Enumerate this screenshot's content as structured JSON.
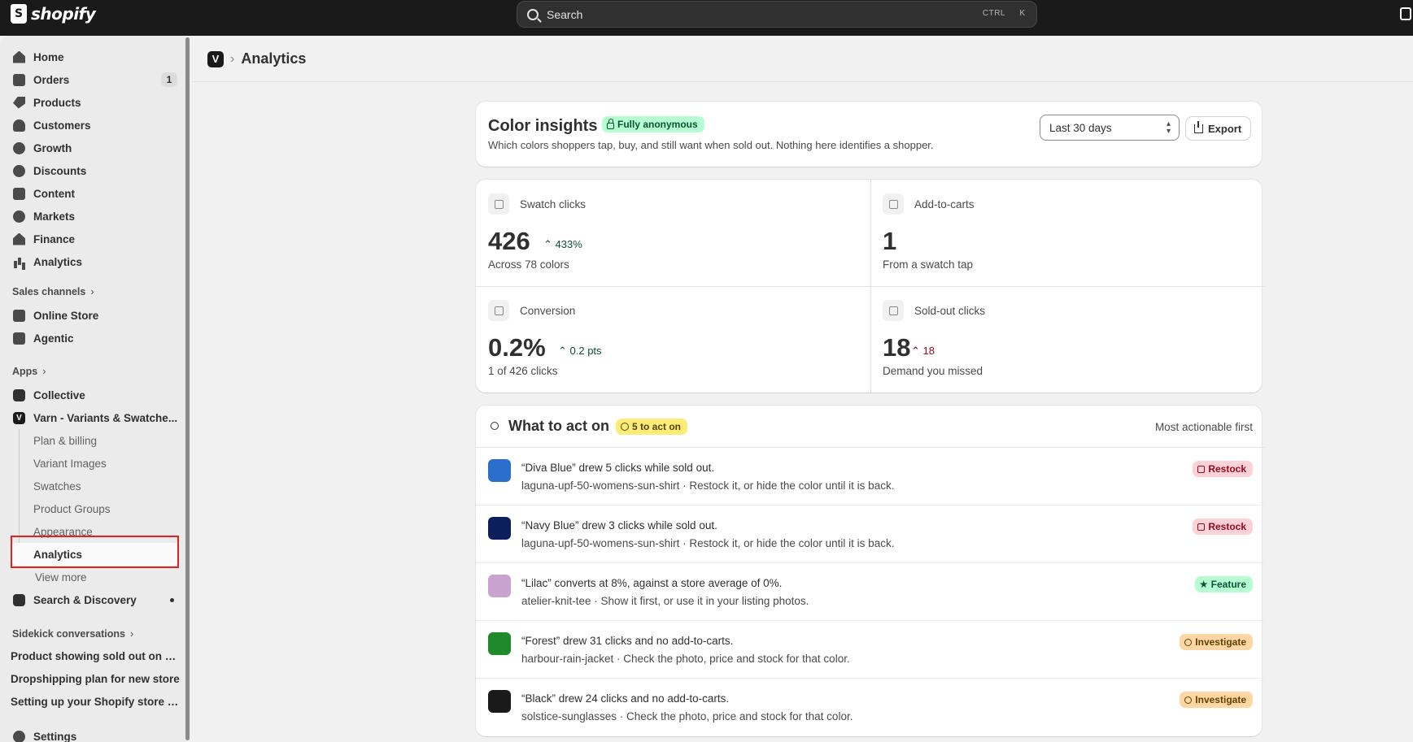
{
  "topbar": {
    "brand": "shopify",
    "search_placeholder": "Search",
    "shortcut_ctrl": "CTRL",
    "shortcut_key": "K"
  },
  "sidebar": {
    "main_items": [
      {
        "label": "Home",
        "icon": "home-icon"
      },
      {
        "label": "Orders",
        "icon": "inbox-icon",
        "badge": "1"
      },
      {
        "label": "Products",
        "icon": "tag-icon"
      },
      {
        "label": "Customers",
        "icon": "person-icon"
      },
      {
        "label": "Growth",
        "icon": "gauge-icon"
      },
      {
        "label": "Discounts",
        "icon": "discount-icon"
      },
      {
        "label": "Content",
        "icon": "content-icon"
      },
      {
        "label": "Markets",
        "icon": "globe-icon"
      },
      {
        "label": "Finance",
        "icon": "bank-icon"
      },
      {
        "label": "Analytics",
        "icon": "bar-chart-icon"
      }
    ],
    "sales_channels_heading": "Sales channels",
    "sales_channels": [
      {
        "label": "Online Store",
        "icon": "store-icon"
      },
      {
        "label": "Agentic",
        "icon": "agent-icon"
      }
    ],
    "apps_heading": "Apps",
    "apps": [
      {
        "label": "Collective",
        "icon": "collective-icon"
      },
      {
        "label": "Varn - Variants & Swatche...",
        "icon": "varn-app-icon"
      }
    ],
    "varn_subitems": [
      "Plan & billing",
      "Variant Images",
      "Swatches",
      "Product Groups",
      "Appearance",
      "Analytics"
    ],
    "view_more": "View more",
    "search_discovery": "Search & Discovery",
    "sidekick_heading": "Sidekick conversations",
    "conversations": [
      "Product showing sold out on st...",
      "Dropshipping plan for new store",
      "Setting up your Shopify store b..."
    ],
    "settings": "Settings"
  },
  "breadcrumb": {
    "title": "Analytics",
    "separator": "›",
    "app_glyph": "V"
  },
  "insights": {
    "title": "Color insights",
    "badge": "Fully anonymous",
    "subtitle": "Which colors shoppers tap, buy, and still want when sold out. Nothing here identifies a shopper.",
    "range": "Last 30 days",
    "export": "Export"
  },
  "stats": [
    {
      "label": "Swatch clicks",
      "value": "426",
      "delta": "433%",
      "delta_trend": "up",
      "foot": "Across 78 colors",
      "icon": "swatch-click-icon"
    },
    {
      "label": "Add-to-carts",
      "value": "1",
      "delta": "",
      "foot": "From a swatch tap",
      "icon": "cart-icon"
    },
    {
      "label": "Conversion",
      "value": "0.2%",
      "delta": "0.2 pts",
      "delta_trend": "up",
      "foot": "1 of 426 clicks",
      "icon": "conversion-icon"
    },
    {
      "label": "Sold-out clicks",
      "value": "18",
      "delta": "18",
      "delta_trend": "up-bad",
      "foot": "Demand you missed",
      "icon": "sold-out-icon"
    }
  ],
  "actions": {
    "title": "What to act on",
    "badge": "5 to act on",
    "sort": "Most actionable first",
    "rows": [
      {
        "swatch_color": "#2c6ecb",
        "title": "“Diva Blue” drew 5 clicks while sold out.",
        "sub": "laguna-upf-50-womens-sun-shirt · Restock it, or hide the color until it is back.",
        "tag": "Restock",
        "tag_kind": "red"
      },
      {
        "swatch_color": "#0b1f5c",
        "title": "“Navy Blue” drew 3 clicks while sold out.",
        "sub": "laguna-upf-50-womens-sun-shirt · Restock it, or hide the color until it is back.",
        "tag": "Restock",
        "tag_kind": "red"
      },
      {
        "swatch_color": "#c9a3cf",
        "title": "“Lilac” converts at 8%, against a store average of 0%.",
        "sub": "atelier-knit-tee · Show it first, or use it in your listing photos.",
        "tag": "Feature",
        "tag_kind": "green"
      },
      {
        "swatch_color": "#1f8a2a",
        "title": "“Forest” drew 31 clicks and no add-to-carts.",
        "sub": "harbour-rain-jacket · Check the photo, price and stock for that color.",
        "tag": "Investigate",
        "tag_kind": "orange"
      },
      {
        "swatch_color": "#1a1a1a",
        "title": "“Black” drew 24 clicks and no add-to-carts.",
        "sub": "solstice-sunglasses · Check the photo, price and stock for that color.",
        "tag": "Investigate",
        "tag_kind": "orange"
      }
    ]
  },
  "colors": {
    "topbar": "#1a1a1a",
    "sidebar": "#ebebeb",
    "highlight_outline": "#e32121",
    "positive": "#0c5132",
    "negative": "#8e0b21"
  }
}
